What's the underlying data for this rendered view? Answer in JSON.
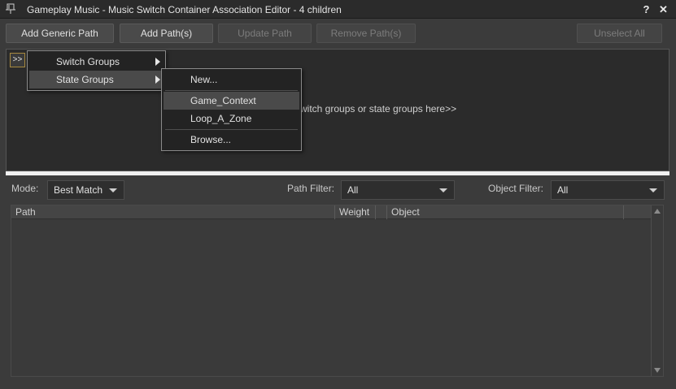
{
  "window": {
    "title": "Gameplay Music - Music Switch Container Association Editor - 4 children",
    "help_label": "?",
    "close_label": "✕"
  },
  "toolbar": {
    "add_generic_path": "Add Generic Path",
    "add_paths": "Add Path(s)",
    "update_path": "Update Path",
    "remove_paths": "Remove Path(s)",
    "unselect_all": "Unselect All"
  },
  "assoc_panel": {
    "expand_label": ">>",
    "hint_text": "witch groups or state groups here>>"
  },
  "context_menu": {
    "items": [
      {
        "label": "Switch Groups",
        "has_submenu": true
      },
      {
        "label": "State Groups",
        "has_submenu": true,
        "highlighted": true
      }
    ]
  },
  "submenu": {
    "items": [
      {
        "label": "New..."
      },
      {
        "label": "Game_Context",
        "highlighted": true
      },
      {
        "label": "Loop_A_Zone"
      },
      {
        "label": "Browse..."
      }
    ]
  },
  "filters": {
    "mode_label": "Mode:",
    "mode_value": "Best Match",
    "path_filter_label": "Path Filter:",
    "path_filter_value": "All",
    "object_filter_label": "Object Filter:",
    "object_filter_value": "All"
  },
  "table": {
    "columns": [
      "Path",
      "Weight",
      "Object"
    ]
  },
  "colors": {
    "background": "#3b3b3b",
    "panel": "#2b2b2b",
    "accent_border": "#a7893f"
  }
}
